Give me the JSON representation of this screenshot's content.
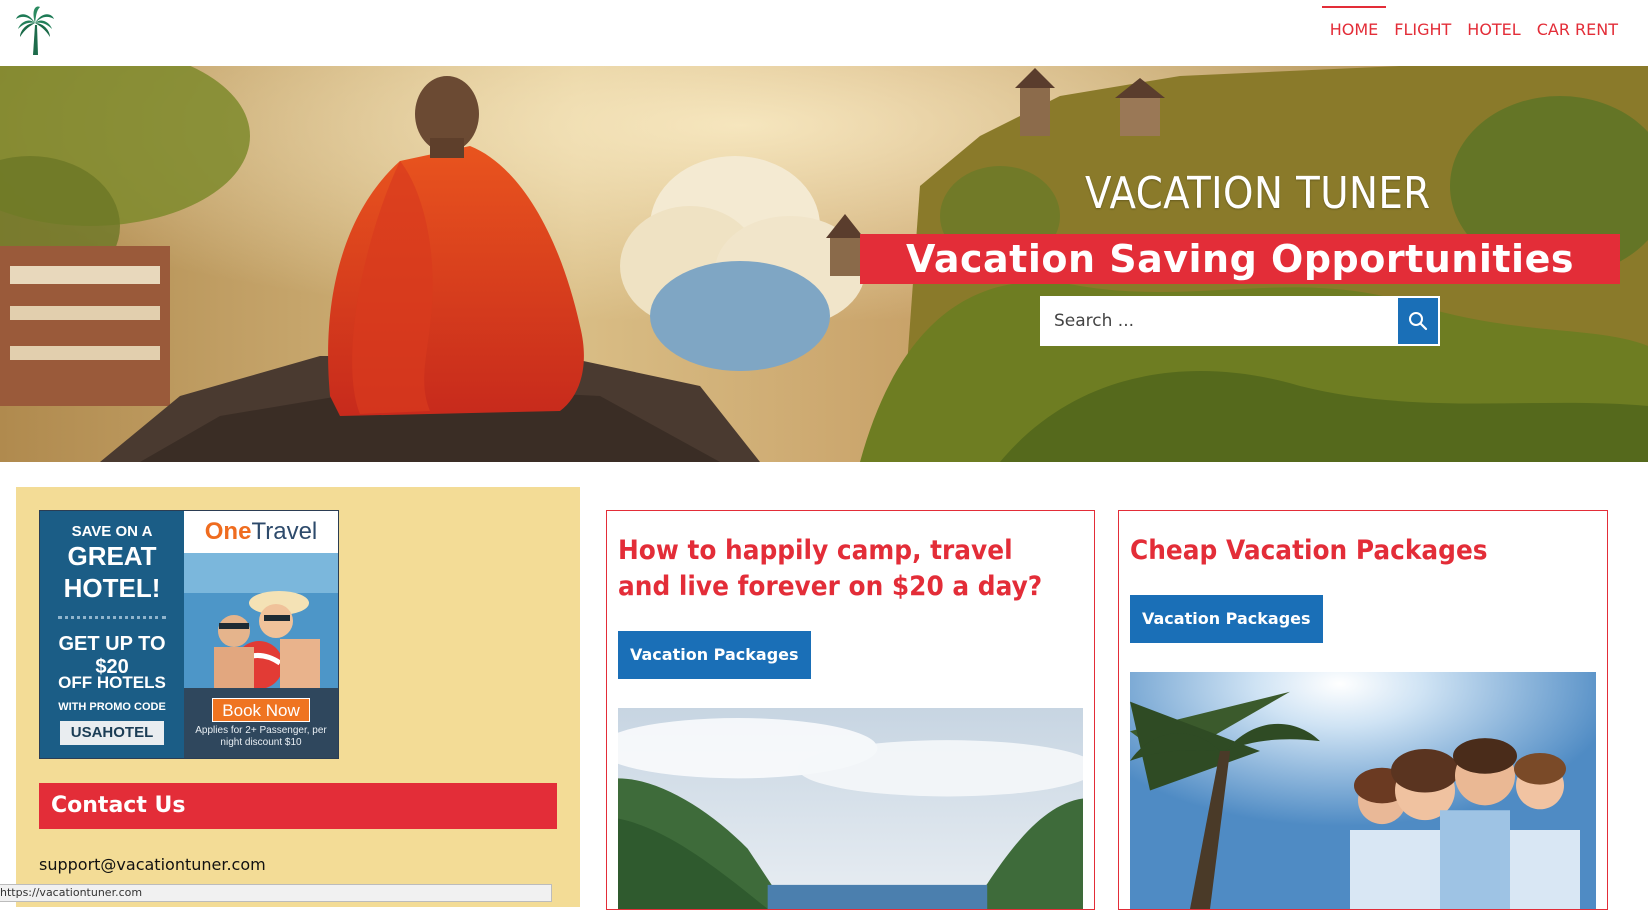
{
  "header": {
    "logo_icon": "palm-tree-icon",
    "nav": [
      {
        "label": "HOME",
        "active": true
      },
      {
        "label": "FLIGHT",
        "active": false
      },
      {
        "label": "HOTEL",
        "active": false
      },
      {
        "label": "CAR RENT",
        "active": false
      }
    ]
  },
  "hero": {
    "site_title": "VACATION TUNER",
    "tagline": "Vacation Saving Opportunities",
    "search": {
      "placeholder": "Search ...",
      "button_icon": "search-icon"
    }
  },
  "sidebar": {
    "ad": {
      "line1": "SAVE ON A",
      "line2": "GREAT",
      "line3": "HOTEL!",
      "offer": "GET UP TO $20",
      "offer_suffix": "OFF HOTELS",
      "promo_label": "WITH PROMO CODE",
      "promo_code": "USAHOTEL",
      "brand_one": "One",
      "brand_travel": "Travel",
      "book_label": "Book Now",
      "note": "Applies for 2+ Passenger, per night discount $10"
    },
    "contact_heading": "Contact Us",
    "contact_email": "support@vacationtuner.com"
  },
  "posts": [
    {
      "title": "How to happily camp, travel and live forever on $20 a day?",
      "button_label": "Vacation Packages"
    },
    {
      "title": "Cheap Vacation Packages",
      "button_label": "Vacation Packages"
    }
  ],
  "status_bar": {
    "url": "https://vacationtuner.com"
  },
  "colors": {
    "accent_red": "#e32d38",
    "button_blue": "#1a6fb7",
    "sidebar_bg": "#f3dc96"
  }
}
